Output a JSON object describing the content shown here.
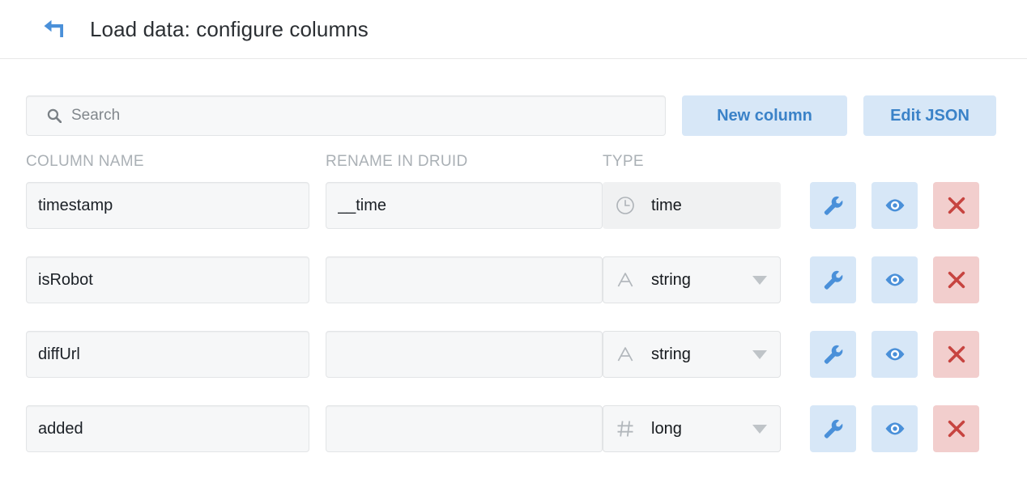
{
  "header": {
    "back_icon": "back-arrow-icon",
    "title": "Load data: configure columns"
  },
  "toolbar": {
    "search_placeholder": "Search",
    "search_value": "",
    "search_icon": "search-icon",
    "new_column_label": "New column",
    "edit_json_label": "Edit JSON"
  },
  "table": {
    "headers": {
      "column_name": "COLUMN NAME",
      "rename_in_druid": "RENAME IN DRUID",
      "type": "TYPE"
    },
    "rows": [
      {
        "column_name": "timestamp",
        "rename": "__time",
        "rename_placeholder": "",
        "type": "time",
        "type_icon": "clock-icon",
        "type_disabled": true,
        "actions": [
          "wrench-icon",
          "eye-icon",
          "close-icon"
        ]
      },
      {
        "column_name": "isRobot",
        "rename": "",
        "rename_placeholder": "",
        "type": "string",
        "type_icon": "letter-a-icon",
        "type_disabled": false,
        "actions": [
          "wrench-icon",
          "eye-icon",
          "close-icon"
        ]
      },
      {
        "column_name": "diffUrl",
        "rename": "",
        "rename_placeholder": "",
        "type": "string",
        "type_icon": "letter-a-icon",
        "type_disabled": false,
        "actions": [
          "wrench-icon",
          "eye-icon",
          "close-icon"
        ]
      },
      {
        "column_name": "added",
        "rename": "",
        "rename_placeholder": "",
        "type": "long",
        "type_icon": "hash-icon",
        "type_disabled": false,
        "actions": [
          "wrench-icon",
          "eye-icon",
          "close-icon"
        ]
      }
    ]
  },
  "colors": {
    "accent_blue": "#3a82c8",
    "button_blue_bg": "#d7e7f7",
    "danger_red": "#c74440",
    "button_red_bg": "#f2cecd",
    "field_bg": "#f6f7f8",
    "label_gray": "#aab0b5"
  }
}
